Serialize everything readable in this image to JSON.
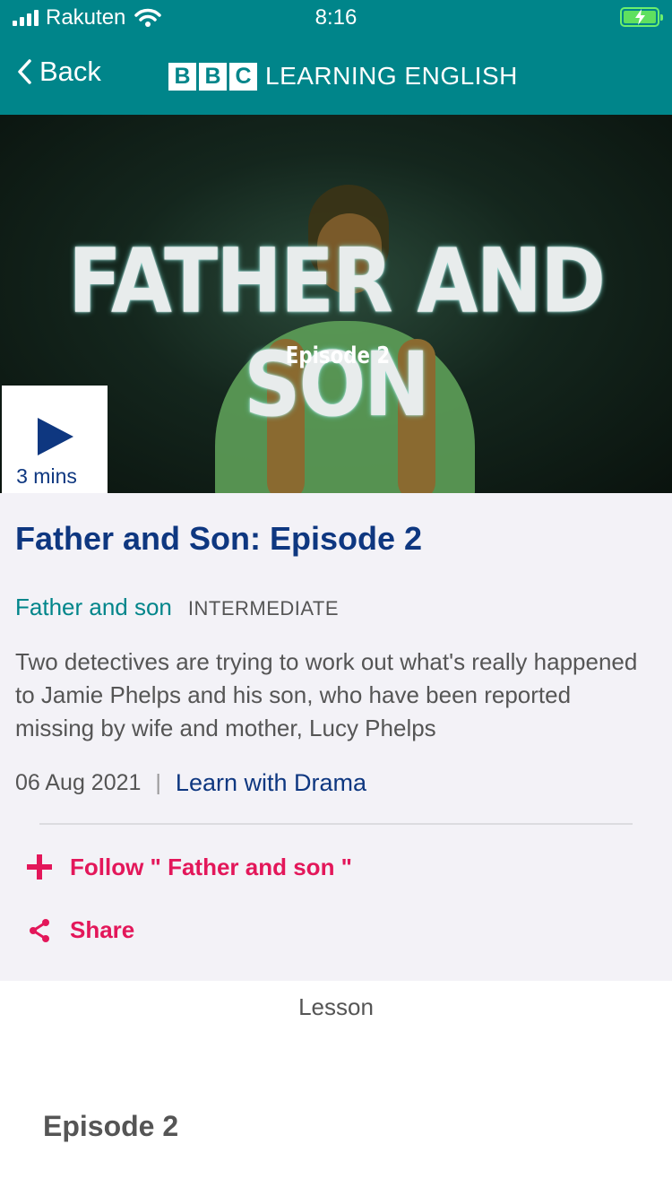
{
  "status_bar": {
    "carrier": "Rakuten",
    "time": "8:16",
    "icons": [
      "signal-bars-icon",
      "wifi-icon",
      "battery-charging-icon"
    ]
  },
  "nav": {
    "back_label": "Back",
    "logo_letters": [
      "B",
      "B",
      "C"
    ],
    "logo_text": "LEARNING ENGLISH"
  },
  "hero": {
    "title": "FATHER AND SON",
    "subtitle": "Episode 2",
    "duration": "3 mins",
    "play_icon": "play-icon"
  },
  "episode": {
    "title": "Father and Son: Episode 2",
    "series": "Father and son",
    "level": "INTERMEDIATE",
    "description": "Two detectives are trying to work out what's really happened to Jamie Phelps and his son, who have been reported missing by wife and mother, Lucy Phelps",
    "date": "06 Aug 2021",
    "separator": "|",
    "category": "Learn with Drama"
  },
  "actions": {
    "follow_label": "Follow \" Father and son \"",
    "share_label": "Share"
  },
  "lesson": {
    "label": "Lesson",
    "heading": "Episode 2"
  },
  "colors": {
    "teal": "#00858a",
    "navy": "#0e3780",
    "pink": "#e3175a",
    "grey_text": "#555555",
    "panel_bg": "#f3f2f7"
  }
}
